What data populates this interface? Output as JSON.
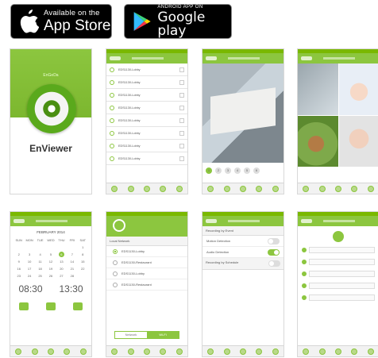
{
  "badges": {
    "apple": {
      "small": "Available on the",
      "big": "App Store",
      "icon": "apple-icon"
    },
    "google": {
      "small": "ANDROID APP ON",
      "big": "Google play",
      "icon": "google-play-icon"
    }
  },
  "splash": {
    "title": "EnGeDa",
    "brand": "EnViewer"
  },
  "cameras": {
    "items": [
      "EDS1130-Lobby",
      "EDS1130-Lobby",
      "EDS1130-Lobby",
      "EDS1130-Lobby",
      "EDS1130-Lobby",
      "EDS1130-Lobby",
      "EDS1130-Lobby",
      "EDS1130-Lobby"
    ]
  },
  "pager": [
    "1",
    "2",
    "3",
    "4",
    "5",
    "6"
  ],
  "schedule": {
    "month": "FEBRUARY 2014",
    "weekdays": [
      "SUN",
      "MON",
      "TUE",
      "WED",
      "THU",
      "FRI",
      "SAT"
    ],
    "days": [
      "",
      "",
      "",
      "",
      "",
      "",
      "1",
      "2",
      "3",
      "4",
      "5",
      "6",
      "7",
      "8",
      "9",
      "10",
      "11",
      "12",
      "13",
      "14",
      "15",
      "16",
      "17",
      "18",
      "19",
      "20",
      "21",
      "22",
      "23",
      "24",
      "25",
      "26",
      "27",
      "28",
      ""
    ],
    "selected_day": "6",
    "from": "08:30",
    "to": "13:30"
  },
  "network": {
    "section": "Local Network",
    "items": [
      "EDS1130-Lobby",
      "EDS1130-Restaurant",
      "EDS1130-Lobby",
      "EDS1130-Restaurant"
    ],
    "seg_left": "Network",
    "seg_right": "Wi-Fi"
  },
  "recording": {
    "section1": "Recording by Event",
    "motion": "Motion Detection",
    "audio": "Audio Detection",
    "section2": "Recording by Schedule"
  },
  "colors": {
    "accent": "#8cc63f",
    "accent_dark": "#6aa61c"
  }
}
